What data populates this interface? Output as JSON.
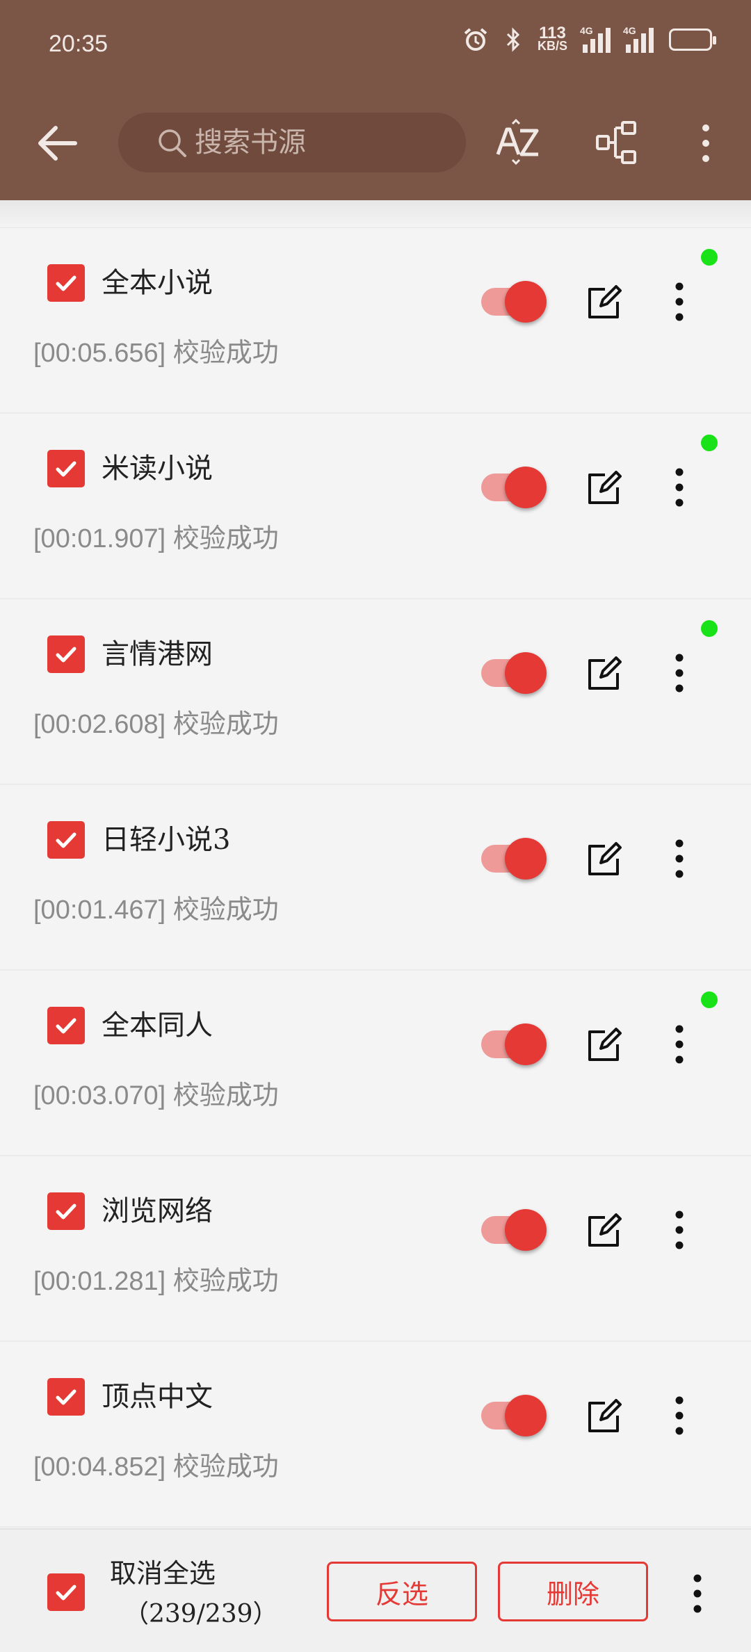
{
  "status": {
    "time": "20:35",
    "speed_value": "113",
    "speed_unit": "KB/S",
    "sig1_tag": "4G",
    "sig2_tag": "4G"
  },
  "toolbar": {
    "search_placeholder": "搜索书源"
  },
  "items": [
    {
      "name": "全本小说",
      "status": "[00:05.656] 校验成功",
      "dot": true
    },
    {
      "name": "米读小说",
      "status": "[00:01.907] 校验成功",
      "dot": true
    },
    {
      "name": "言情港网",
      "status": "[00:02.608] 校验成功",
      "dot": true
    },
    {
      "name": "日轻小说3",
      "status": "[00:01.467] 校验成功",
      "dot": false
    },
    {
      "name": "全本同人",
      "status": "[00:03.070] 校验成功",
      "dot": true
    },
    {
      "name": "浏览网络",
      "status": "[00:01.281] 校验成功",
      "dot": false
    },
    {
      "name": "顶点中文",
      "status": "[00:04.852] 校验成功",
      "dot": false
    }
  ],
  "bottom": {
    "select_label": "取消全选",
    "count": "（239/239）",
    "invert_label": "反选",
    "delete_label": "删除"
  },
  "colors": {
    "header": "#7b5546",
    "accent": "#e53935",
    "dot": "#19e219"
  }
}
